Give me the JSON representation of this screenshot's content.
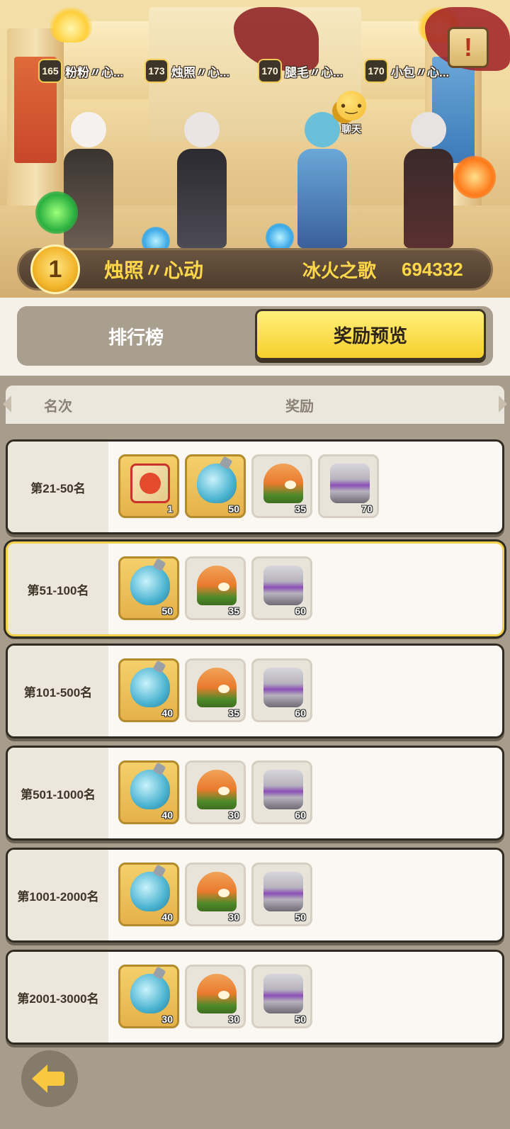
{
  "hero": {
    "top_players": [
      {
        "level": "165",
        "name": "粉粉〃心..."
      },
      {
        "level": "173",
        "name": "烛照〃心..."
      },
      {
        "level": "170",
        "name": "腿毛〃心..."
      },
      {
        "level": "170",
        "name": "小包〃心..."
      }
    ],
    "chat_label": "聊天",
    "scroll_icon_text": "!",
    "champion": {
      "rank": "1",
      "name": "烛照〃心动",
      "guild": "冰火之歌",
      "score": "694332"
    }
  },
  "tabs": {
    "ranking": "排行榜",
    "reward_preview": "奖励预览",
    "active": "reward_preview"
  },
  "table": {
    "col_rank": "名次",
    "col_reward": "奖励"
  },
  "rows": [
    {
      "rank": "第21-50名",
      "items": [
        {
          "icon": "dragon-card-icon",
          "count": "1",
          "gold": true
        },
        {
          "icon": "potion-icon",
          "count": "50",
          "gold": true
        },
        {
          "icon": "food-icon",
          "count": "35",
          "gold": false
        },
        {
          "icon": "chest-icon",
          "count": "70",
          "gold": false
        }
      ]
    },
    {
      "rank": "第51-100名",
      "highlighted": true,
      "items": [
        {
          "icon": "potion-icon",
          "count": "50",
          "gold": true
        },
        {
          "icon": "food-icon",
          "count": "35",
          "gold": false
        },
        {
          "icon": "chest-icon",
          "count": "60",
          "gold": false
        }
      ]
    },
    {
      "rank": "第101-500名",
      "items": [
        {
          "icon": "potion-icon",
          "count": "40",
          "gold": true
        },
        {
          "icon": "food-icon",
          "count": "35",
          "gold": false
        },
        {
          "icon": "chest-icon",
          "count": "60",
          "gold": false
        }
      ]
    },
    {
      "rank": "第501-1000名",
      "items": [
        {
          "icon": "potion-icon",
          "count": "40",
          "gold": true
        },
        {
          "icon": "food-icon",
          "count": "30",
          "gold": false
        },
        {
          "icon": "chest-icon",
          "count": "60",
          "gold": false
        }
      ]
    },
    {
      "rank": "第1001-2000名",
      "items": [
        {
          "icon": "potion-icon",
          "count": "40",
          "gold": true
        },
        {
          "icon": "food-icon",
          "count": "30",
          "gold": false
        },
        {
          "icon": "chest-icon",
          "count": "50",
          "gold": false
        }
      ]
    },
    {
      "rank": "第2001-3000名",
      "items": [
        {
          "icon": "potion-icon",
          "count": "30",
          "gold": true
        },
        {
          "icon": "food-icon",
          "count": "30",
          "gold": false
        },
        {
          "icon": "chest-icon",
          "count": "50",
          "gold": false
        }
      ]
    }
  ],
  "colors": {
    "accent_gold": "#f6cf2c",
    "champion_text": "#ffd84a",
    "panel_bg": "#a89d8c"
  }
}
